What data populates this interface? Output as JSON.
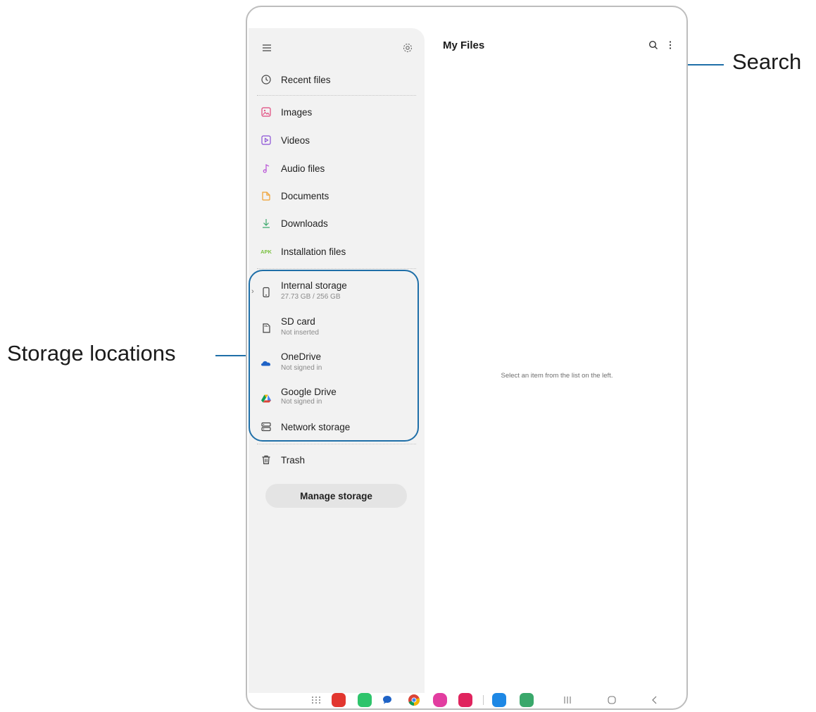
{
  "app": {
    "title": "My Files"
  },
  "drawer": {
    "items": [
      {
        "label": "Recent files",
        "icon": "clock-icon"
      },
      {
        "label": "Images",
        "icon": "image-icon"
      },
      {
        "label": "Videos",
        "icon": "video-icon"
      },
      {
        "label": "Audio files",
        "icon": "music-note-icon"
      },
      {
        "label": "Documents",
        "icon": "document-icon"
      },
      {
        "label": "Downloads",
        "icon": "download-icon"
      },
      {
        "label": "Installation files",
        "icon": "apk-icon",
        "icon_text": "APK"
      }
    ],
    "storage": [
      {
        "label": "Internal storage",
        "sub": "27.73 GB / 256 GB",
        "icon": "phone-icon"
      },
      {
        "label": "SD card",
        "sub": "Not inserted",
        "icon": "sd-card-icon"
      },
      {
        "label": "OneDrive",
        "sub": "Not signed in",
        "icon": "onedrive-icon"
      },
      {
        "label": "Google Drive",
        "sub": "Not signed in",
        "icon": "google-drive-icon"
      },
      {
        "label": "Network storage",
        "sub": "",
        "icon": "network-storage-icon"
      }
    ],
    "trash": {
      "label": "Trash",
      "icon": "trash-icon"
    },
    "manage_button": "Manage storage"
  },
  "main": {
    "empty_message": "Select an item from the list on the left."
  },
  "callouts": {
    "search": "Search",
    "storage": "Storage locations"
  },
  "colors": {
    "callout": "#1f6fa8",
    "images": "#e0457b",
    "videos": "#8a4fd6",
    "audio": "#b84fd6",
    "documents": "#f0a030",
    "downloads": "#3aa86b",
    "apk": "#7cc243"
  }
}
